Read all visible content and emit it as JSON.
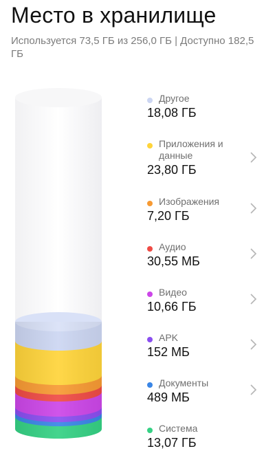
{
  "header": {
    "title": "Место в хранилище",
    "subtitle": "Используется 73,5 ГБ из 256,0 ГБ | Доступно 182,5 ГБ"
  },
  "colors": {
    "other": "#ccd6f2",
    "apps": "#ffd43a",
    "images": "#f79a33",
    "audio": "#ef4b45",
    "video": "#cc46e8",
    "apk": "#8a4ef0",
    "documents": "#3a86e6",
    "system": "#35d184",
    "chevron": "#b5b5b5"
  },
  "categories": [
    {
      "key": "other",
      "label": "Другое",
      "size": "18,08 ГБ",
      "chevron": false
    },
    {
      "key": "apps",
      "label": "Приложения и данные",
      "size": "23,80 ГБ",
      "chevron": true
    },
    {
      "key": "images",
      "label": "Изображения",
      "size": "7,20 ГБ",
      "chevron": true
    },
    {
      "key": "audio",
      "label": "Аудио",
      "size": "30,55 МБ",
      "chevron": true
    },
    {
      "key": "video",
      "label": "Видео",
      "size": "10,66 ГБ",
      "chevron": true
    },
    {
      "key": "apk",
      "label": "APK",
      "size": "152 МБ",
      "chevron": true
    },
    {
      "key": "documents",
      "label": "Документы",
      "size": "489 МБ",
      "chevron": true
    },
    {
      "key": "system",
      "label": "Система",
      "size": "13,07 ГБ",
      "chevron": false
    }
  ]
}
